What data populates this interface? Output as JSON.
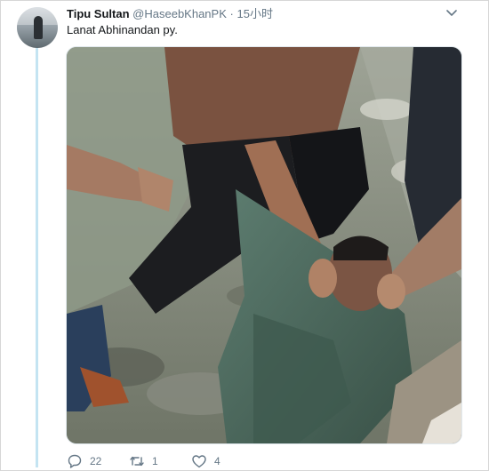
{
  "tweet": {
    "author_name": "Tipu Sultan",
    "handle": "@HaseebKhanPK",
    "separator": "·",
    "time": "15小时",
    "text": "Lanat Abhinandan py.",
    "replies": "22",
    "retweets": "1",
    "likes": "4"
  },
  "icons": {
    "menu": "chevron-down-icon",
    "reply": "speech-bubble-icon",
    "retweet": "retweet-arrows-icon",
    "like": "heart-icon"
  },
  "colors": {
    "name_text": "#14171a",
    "secondary_text": "#657786",
    "thread_line": "#c4e4f2",
    "border": "#d6d6d6"
  }
}
